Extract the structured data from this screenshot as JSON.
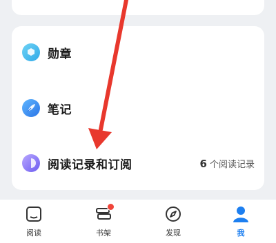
{
  "menu": {
    "items": [
      {
        "icon": "medal-icon",
        "label": "勋章"
      },
      {
        "icon": "feather-icon",
        "label": "笔记"
      },
      {
        "icon": "reading-record-icon",
        "label": "阅读记录和订阅",
        "count": "6",
        "suffix": "个阅读记录"
      }
    ]
  },
  "bottom_nav": {
    "tabs": [
      {
        "icon": "book-icon",
        "label": "阅读",
        "active": false
      },
      {
        "icon": "bookshelf-icon",
        "label": "书架",
        "active": false,
        "badge": true
      },
      {
        "icon": "compass-icon",
        "label": "发现",
        "active": false
      },
      {
        "icon": "person-icon",
        "label": "我",
        "active": true
      }
    ]
  },
  "colors": {
    "accent": "#1d7ff0",
    "annotation_arrow": "#e8382d",
    "badge": "#f0453a"
  }
}
